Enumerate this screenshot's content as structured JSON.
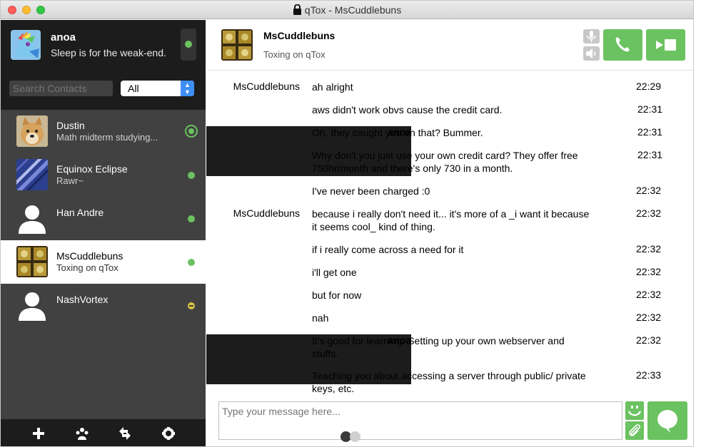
{
  "window": {
    "title": "qTox - MsCuddlebuns"
  },
  "self": {
    "name": "anoa",
    "status_message": "Sleep is for the weak-end.",
    "status": "online"
  },
  "search": {
    "placeholder": "Search Contacts",
    "filter_value": "All"
  },
  "contacts": [
    {
      "name": "Dustin",
      "status_message": "Math midterm studying...",
      "status": "online-notify",
      "avatar": "doge"
    },
    {
      "name": "Equinox Eclipse",
      "status_message": "Rawr~",
      "status": "online",
      "avatar": "eclipse"
    },
    {
      "name": "Han Andre",
      "status_message": "",
      "status": "online",
      "avatar": "default-person"
    },
    {
      "name": "MsCuddlebuns",
      "status_message": "Toxing on qTox",
      "status": "online",
      "avatar": "pattern",
      "active": true
    },
    {
      "name": "NashVortex",
      "status_message": "",
      "status": "away",
      "avatar": "default-person"
    }
  ],
  "chat": {
    "contact_name": "MsCuddlebuns",
    "contact_status": "Toxing on qTox",
    "messages": [
      {
        "author": "MsCuddlebuns",
        "self": false,
        "text": "ah alright",
        "time": "22:29"
      },
      {
        "author": "",
        "self": false,
        "text": "aws didn't work obvs cause the credit card.",
        "time": "22:31"
      },
      {
        "author": "anoa",
        "self": true,
        "text": "Oh, they caught you on that? Bummer.",
        "time": "22:31"
      },
      {
        "author": "",
        "self": true,
        "text": "Why don't you just use your own credit card? They offer free 750hr/month and there's only 730 in a month.",
        "time": "22:31"
      },
      {
        "author": "",
        "self": true,
        "text": "I've never been charged :0",
        "time": "22:32"
      },
      {
        "author": "MsCuddlebuns",
        "self": false,
        "text": "because i really don't need it... it's more of a _i want it because it seems cool_ kind of thing.",
        "time": "22:32"
      },
      {
        "author": "",
        "self": false,
        "text": "if i really come across a need for it",
        "time": "22:32"
      },
      {
        "author": "",
        "self": false,
        "text": "i'll get one",
        "time": "22:32"
      },
      {
        "author": "",
        "self": false,
        "text": "but for now",
        "time": "22:32"
      },
      {
        "author": "",
        "self": false,
        "text": "nah",
        "time": "22:32"
      },
      {
        "author": "anoa",
        "self": true,
        "text": "It's good for learning. Setting up your own webserver and stuffs.",
        "time": "22:32"
      },
      {
        "author": "",
        "self": true,
        "text": "Teaching you about accessing a server through public/ private keys, etc.",
        "time": "22:33"
      }
    ],
    "input_placeholder": "Type your message here..."
  },
  "icons": {
    "bottom_bar": [
      "add-friend-icon",
      "group-icon",
      "file-transfer-icon",
      "settings-icon"
    ],
    "header": [
      "microphone-icon",
      "volume-icon",
      "phone-icon",
      "video-icon"
    ],
    "input": [
      "emoticon-icon",
      "attach-icon",
      "send-icon"
    ]
  },
  "colors": {
    "accent": "#6bc260",
    "sidebar_dark": "#1c1c1c",
    "sidebar": "#414141",
    "away": "#d8c43f",
    "select_arrow": "#3d8ef7"
  }
}
